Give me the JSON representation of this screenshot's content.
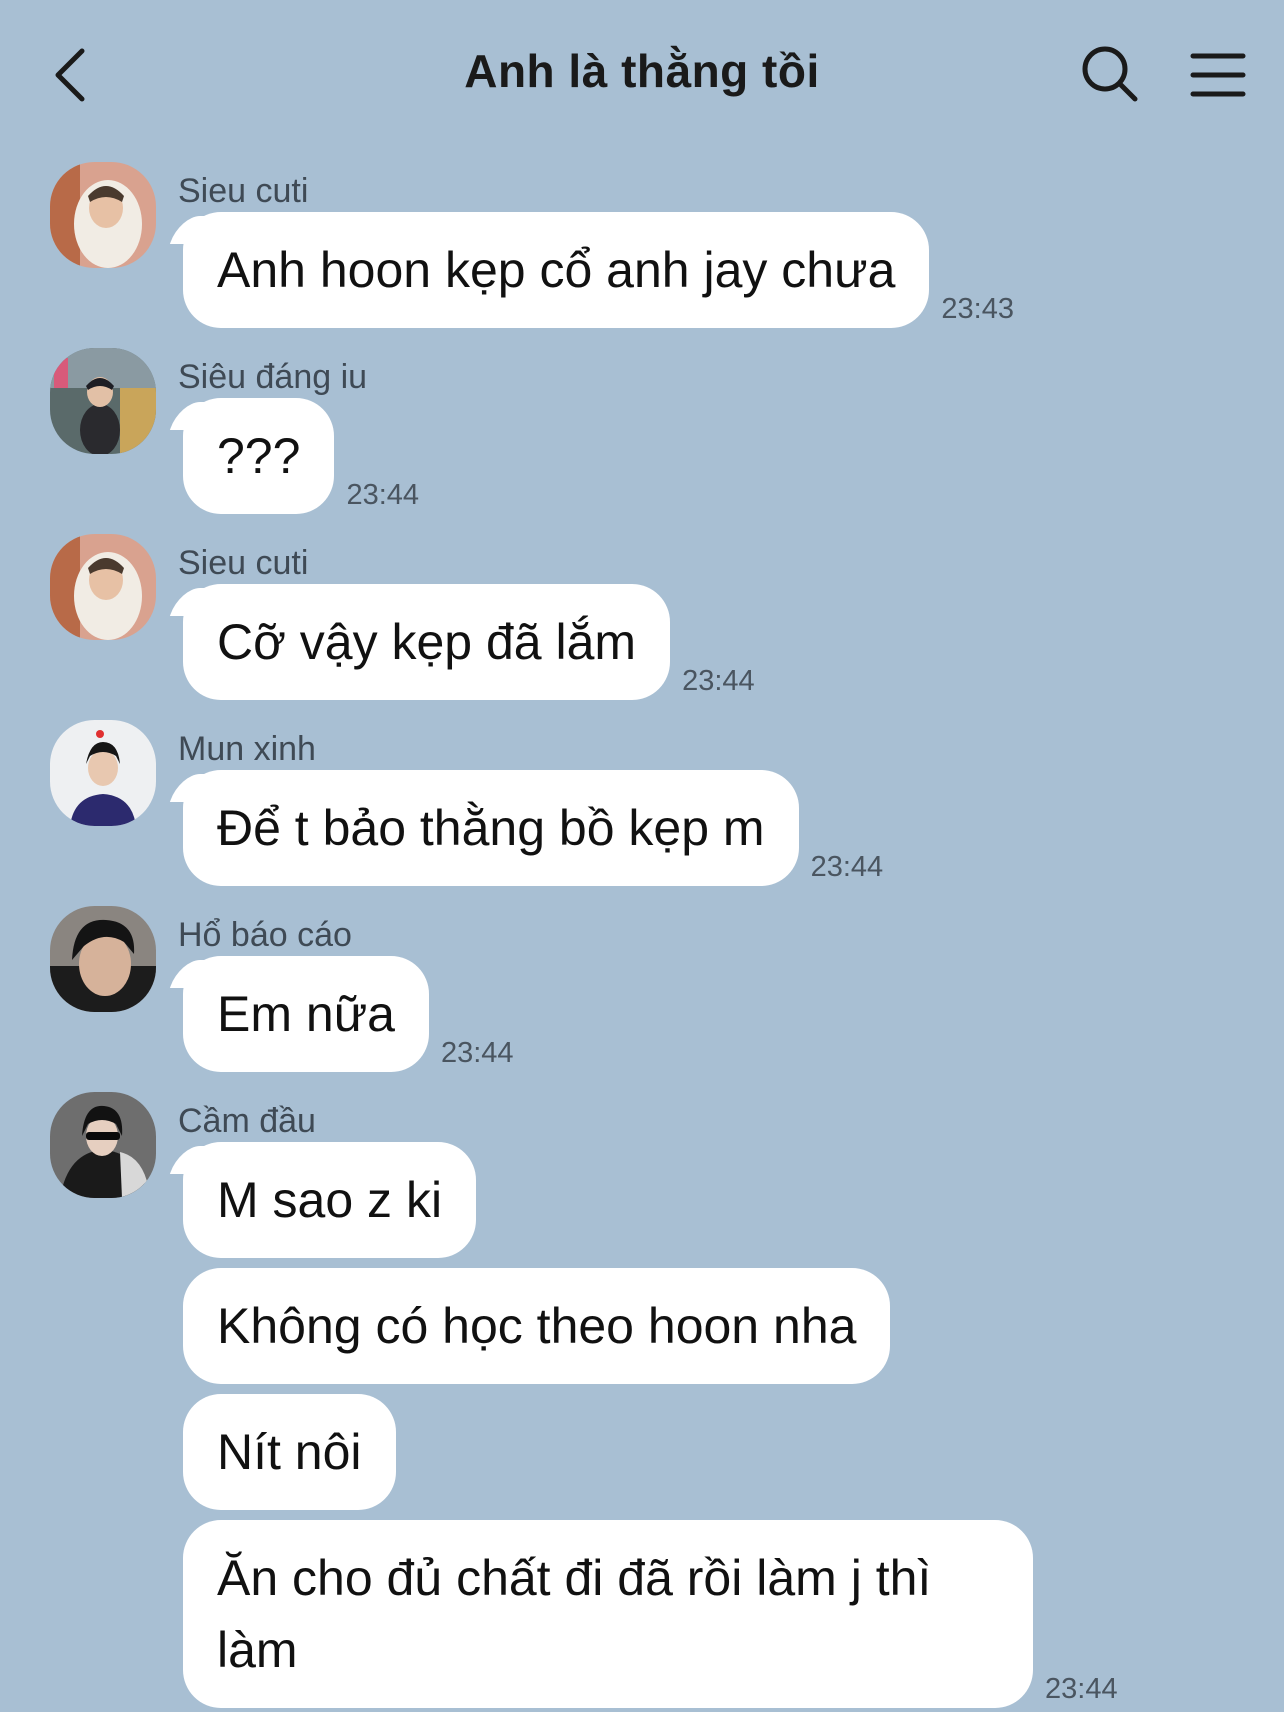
{
  "header": {
    "title": "Anh là thằng tồi"
  },
  "messages": [
    {
      "sender": "Sieu cuti",
      "text": "Anh hoon kẹp cổ anh jay chưa",
      "time": "23:43"
    },
    {
      "sender": "Siêu đáng iu",
      "text": "???",
      "time": "23:44"
    },
    {
      "sender": "Sieu cuti",
      "text": "Cỡ vậy kẹp đã lắm",
      "time": "23:44"
    },
    {
      "sender": "Mun xinh",
      "text": "Để t bảo thằng bồ kẹp m",
      "time": "23:44"
    },
    {
      "sender": "Hổ báo cáo",
      "text": "Em nữa",
      "time": "23:44"
    },
    {
      "sender": "Cầm đầu",
      "texts": [
        "M sao z ki",
        "Không có học theo hoon nha",
        "Nít nôi",
        "Ăn cho đủ chất đi đã rồi làm j thì làm"
      ],
      "time": "23:44"
    }
  ],
  "colors": {
    "background": "#a8bfd3",
    "bubble": "#ffffff"
  }
}
